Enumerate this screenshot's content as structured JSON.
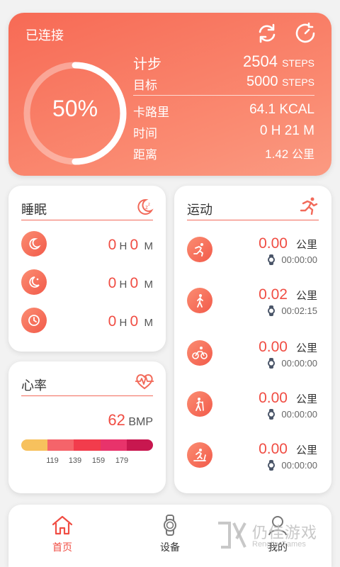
{
  "header": {
    "status": "已连接",
    "percent": "50%",
    "percent_value": 0.5,
    "steps_label": "计步",
    "steps_value": "2504",
    "steps_unit": "STEPS",
    "goal_label": "目标",
    "goal_value": "5000",
    "goal_unit": "STEPS",
    "calories_label": "卡路里",
    "calories_value": "64.1 KCAL",
    "time_label": "时间",
    "time_value": "0 H 21 M",
    "distance_label": "距离",
    "distance_value": "1.42",
    "distance_unit": "公里",
    "icons": [
      "sync-icon",
      "refresh-icon"
    ]
  },
  "sleep": {
    "title": "睡眠",
    "rows": [
      {
        "icon": "moon-icon",
        "h": "0",
        "h_unit": "H",
        "m": "0",
        "m_unit": "M"
      },
      {
        "icon": "moon-star-icon",
        "h": "0",
        "h_unit": "H",
        "m": "0",
        "m_unit": "M"
      },
      {
        "icon": "clock-icon",
        "h": "0",
        "h_unit": "H",
        "m": "0",
        "m_unit": "M"
      }
    ]
  },
  "heart": {
    "title": "心率",
    "value": "62",
    "unit": "BMP",
    "ticks": [
      "119",
      "139",
      "159",
      "179"
    ],
    "zone_colors": [
      "#f7c15d",
      "#f5646a",
      "#f23c4c",
      "#e8336b",
      "#c8174f"
    ]
  },
  "sport": {
    "title": "运动",
    "items": [
      {
        "icon": "run-icon",
        "distance": "0.00",
        "unit": "公里",
        "time": "00:00:00"
      },
      {
        "icon": "walk-icon",
        "distance": "0.02",
        "unit": "公里",
        "time": "00:02:15"
      },
      {
        "icon": "bike-icon",
        "distance": "0.00",
        "unit": "公里",
        "time": "00:00:00"
      },
      {
        "icon": "hike-icon",
        "distance": "0.00",
        "unit": "公里",
        "time": "00:00:00"
      },
      {
        "icon": "treadmill-icon",
        "distance": "0.00",
        "unit": "公里",
        "time": "00:00:00"
      }
    ]
  },
  "nav": {
    "home": "首页",
    "device": "设备",
    "me": "我的"
  },
  "watermark": {
    "main": "仍佳游戏",
    "sub": "Rengjia Games"
  },
  "colors": {
    "accent": "#f04d43",
    "header_start": "#f76a55",
    "header_end": "#fb9a82"
  }
}
